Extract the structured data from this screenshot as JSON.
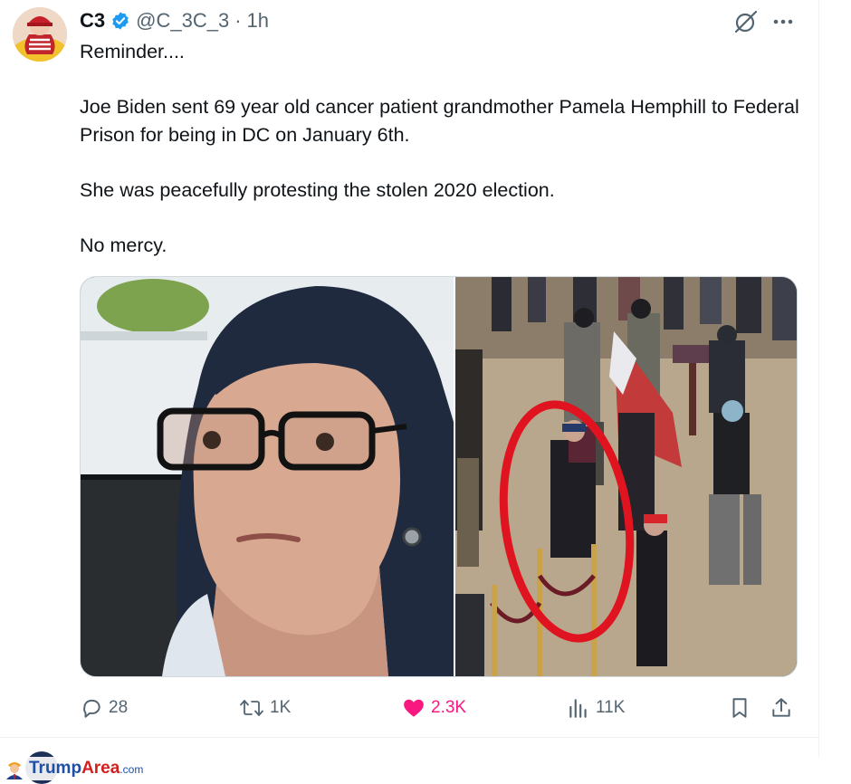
{
  "post": {
    "display_name": "C3",
    "handle": "@C_3C_3",
    "separator": "·",
    "time": "1h",
    "text": [
      "Reminder....",
      "Joe Biden sent 69 year old cancer patient grandmother Pamela Hemphill to Federal Prison for being in DC on January 6th.",
      "She was peacefully protesting the stolen 2020 election.",
      "No mercy."
    ],
    "icons": {
      "verified": "verified-badge-icon",
      "grok": "grok-icon",
      "more": "more-icon"
    }
  },
  "media": {
    "left_photo": "elderly-woman-headscarf-glasses-car-photo",
    "right_photo": "capitol-rotunda-crowd-red-circle-photo"
  },
  "actions": {
    "replies": "28",
    "reposts": "1K",
    "likes": "2.3K",
    "views": "11K",
    "icons": [
      "reply-icon",
      "repost-icon",
      "like-icon",
      "views-icon",
      "bookmark-icon",
      "share-icon"
    ]
  },
  "watermark": {
    "brand_trump": "Trump",
    "brand_area": "Area",
    "brand_tld": ".com"
  },
  "colors": {
    "text": "#0f1419",
    "secondary": "#536471",
    "verified": "#1d9bf0",
    "like": "#f91880",
    "divider": "#eff3f4"
  }
}
